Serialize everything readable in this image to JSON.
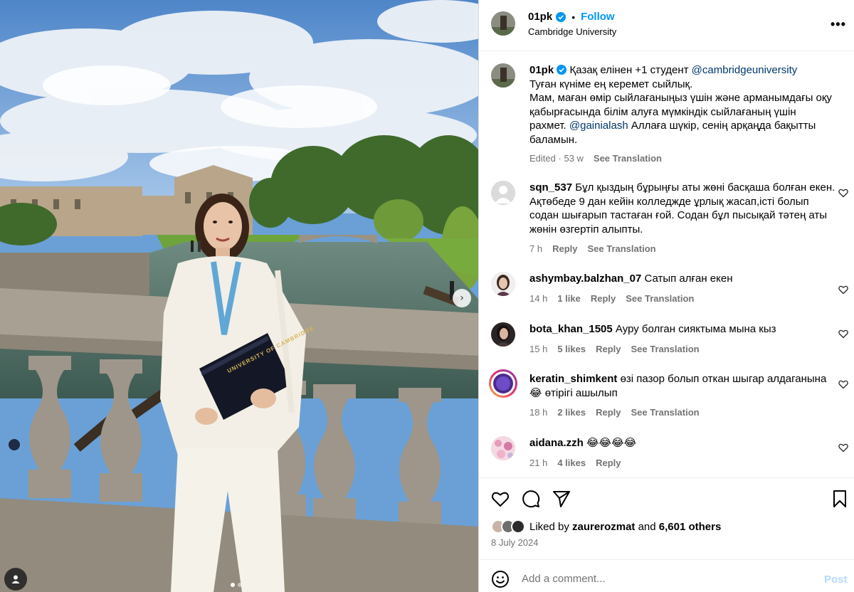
{
  "post": {
    "username": "01pk",
    "follow_label": "Follow",
    "location": "Cambridge University",
    "more_label": "•••",
    "caption_first": "Қазақ елінен +1 студент",
    "caption_mention_1": "@cambridgeuniversity",
    "caption_line_2": "Туған күніме ең керемет сыйлық.",
    "caption_line_3": "Мам, маған өмір сыйлағаныңыз үшін және арманымдағы оқу қабырғасында білім алуға мүмкіндік сыйлағаның үшін рахмет.",
    "caption_mention_2": "@gainialash",
    "caption_tail": "Аллаға шүкір, сенің арқаңда бақытты баламын.",
    "edited": "Edited",
    "age": "53 w",
    "see_translation": "See Translation"
  },
  "image": {
    "book_text": "UNIVERSITY OF CAMBRIDGE",
    "next_icon": "chevron-right-icon",
    "slide_count": 2,
    "active_slide": 1
  },
  "comments": [
    {
      "user": "sqn_537",
      "text": "Бұл қыздың бұрыңғы аты жөні басқаша болған екен. Ақтөбеде 9 дан кейін колледжде ұрлық жасап,істі болып содан шығарып тастаған ғой. Содан бұл пысықай тәтең аты жөнін өзгертіп алыпты.",
      "age": "7 h",
      "likes": "",
      "reply": "Reply",
      "translate": "See Translation"
    },
    {
      "user": "ashymbay.balzhan_07",
      "text": "Сатып алған екен",
      "age": "14 h",
      "likes": "1 like",
      "reply": "Reply",
      "translate": "See Translation"
    },
    {
      "user": "bota_khan_1505",
      "text": "Ауру болган сияктыма мына кыз",
      "age": "15 h",
      "likes": "5 likes",
      "reply": "Reply",
      "translate": "See Translation"
    },
    {
      "user": "keratin_shimkent",
      "text": "өзі пазор болып откан шыгар алдаганына😂 өтірігі ашылып",
      "age": "18 h",
      "likes": "2 likes",
      "reply": "Reply",
      "translate": "See Translation"
    },
    {
      "user": "aidana.zzh",
      "text": "😂😂😂😂",
      "age": "21 h",
      "likes": "4 likes",
      "reply": "Reply",
      "translate": ""
    }
  ],
  "likes": {
    "prefix": "Liked by",
    "user": "zaurerozmat",
    "and": "and",
    "others": "6,601 others",
    "date": "8 July 2024"
  },
  "composer": {
    "placeholder": "Add a comment...",
    "post_label": "Post"
  },
  "colors": {
    "accent": "#0095f6",
    "mention": "#00376b",
    "muted": "#737373",
    "post_disabled": "#b3dbff"
  }
}
